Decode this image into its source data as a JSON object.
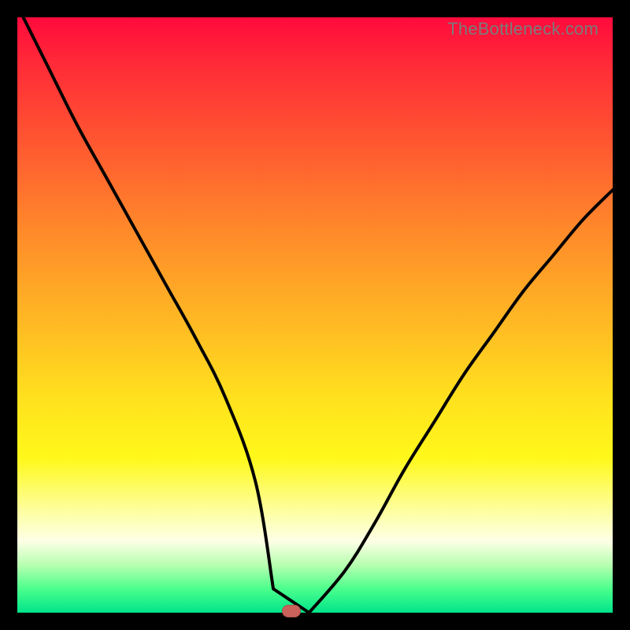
{
  "watermark": "TheBottleneck.com",
  "marker": {
    "x_pct": 46,
    "y_pct": 0
  },
  "chart_data": {
    "type": "line",
    "title": "",
    "xlabel": "",
    "ylabel": "",
    "xlim": [
      0,
      100
    ],
    "ylim": [
      0,
      100
    ],
    "flat_range": [
      43,
      49
    ],
    "series": [
      {
        "name": "curve",
        "x": [
          1,
          5,
          10,
          15,
          20,
          25,
          30,
          35,
          40,
          43,
          46,
          49,
          55,
          60,
          65,
          70,
          75,
          80,
          85,
          90,
          95,
          100
        ],
        "values": [
          100,
          92,
          82,
          73,
          64,
          55,
          46,
          36,
          22,
          4,
          0,
          0,
          7,
          15,
          24,
          32,
          40,
          47,
          54,
          60,
          66,
          71
        ]
      }
    ],
    "grid": false,
    "legend": false
  }
}
